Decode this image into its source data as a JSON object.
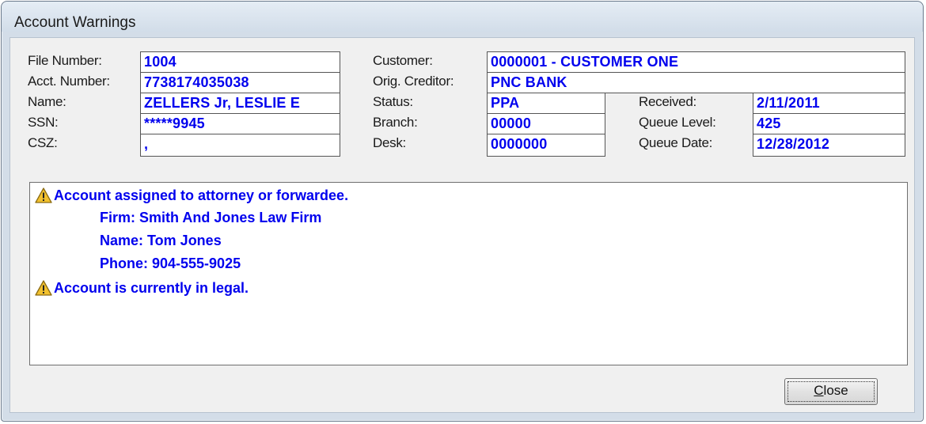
{
  "window": {
    "title": "Account Warnings"
  },
  "fields": {
    "file_number": {
      "label": "File Number:",
      "value": "1004"
    },
    "acct_number": {
      "label": "Acct. Number:",
      "value": "7738174035038"
    },
    "name": {
      "label": "Name:",
      "value": "ZELLERS Jr, LESLIE E"
    },
    "ssn": {
      "label": "SSN:",
      "value": "*****9945"
    },
    "csz": {
      "label": "CSZ:",
      "value": ","
    },
    "customer": {
      "label": "Customer:",
      "value": "0000001 - CUSTOMER ONE"
    },
    "orig_creditor": {
      "label": "Orig. Creditor:",
      "value": "PNC BANK"
    },
    "status": {
      "label": "Status:",
      "value": "PPA"
    },
    "branch": {
      "label": "Branch:",
      "value": "00000"
    },
    "desk": {
      "label": "Desk:",
      "value": "0000000"
    },
    "received": {
      "label": "Received:",
      "value": "2/11/2011"
    },
    "queue_level": {
      "label": "Queue Level:",
      "value": "425"
    },
    "queue_date": {
      "label": "Queue Date:",
      "value": "12/28/2012"
    }
  },
  "warnings": [
    {
      "icon": "warning-icon",
      "text": "Account assigned to attorney or forwardee.",
      "details": [
        "Firm: Smith And Jones Law Firm",
        "Name: Tom Jones",
        "Phone: 904-555-9025"
      ]
    },
    {
      "icon": "warning-icon",
      "text": "Account is currently in legal.",
      "details": []
    }
  ],
  "buttons": {
    "close": "Close"
  },
  "colors": {
    "value_text": "#0000ee",
    "warning_icon": "#f2c12e"
  }
}
